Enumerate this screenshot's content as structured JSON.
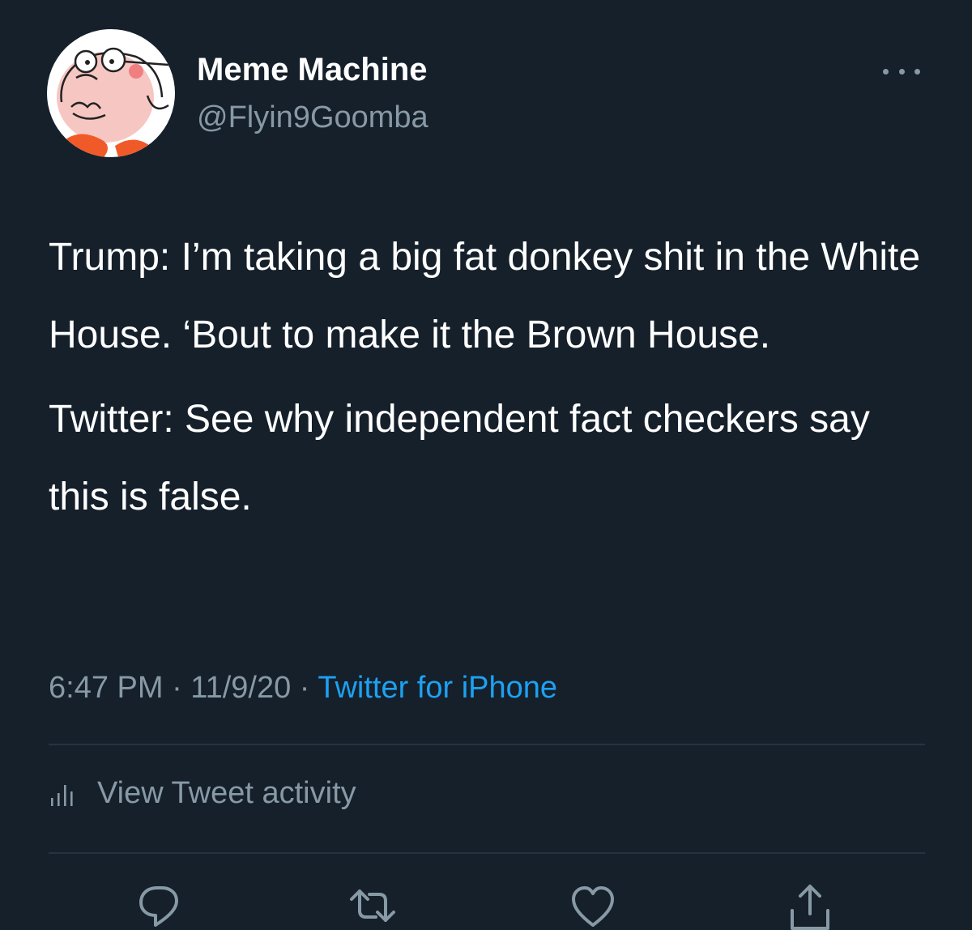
{
  "tweet": {
    "display_name": "Meme Machine",
    "handle": "@Flyin9Goomba",
    "body_paragraphs": [
      "Trump: I’m taking a big fat donkey shit in the White House.  ‘Bout to make it the Brown House.",
      "Twitter: See why independent fact checkers say this is false."
    ],
    "timestamp": "6:47 PM · 11/9/20 · ",
    "source": "Twitter for iPhone",
    "activity_label": "View Tweet activity"
  },
  "icons": {
    "more": "more-dots-icon",
    "activity": "bar-chart-icon",
    "reply": "reply-icon",
    "retweet": "retweet-icon",
    "like": "heart-icon",
    "share": "share-icon"
  },
  "colors": {
    "background": "#15202b",
    "text_primary": "#ffffff",
    "text_secondary": "#8899a6",
    "accent": "#1da1f2",
    "divider": "#253341"
  }
}
